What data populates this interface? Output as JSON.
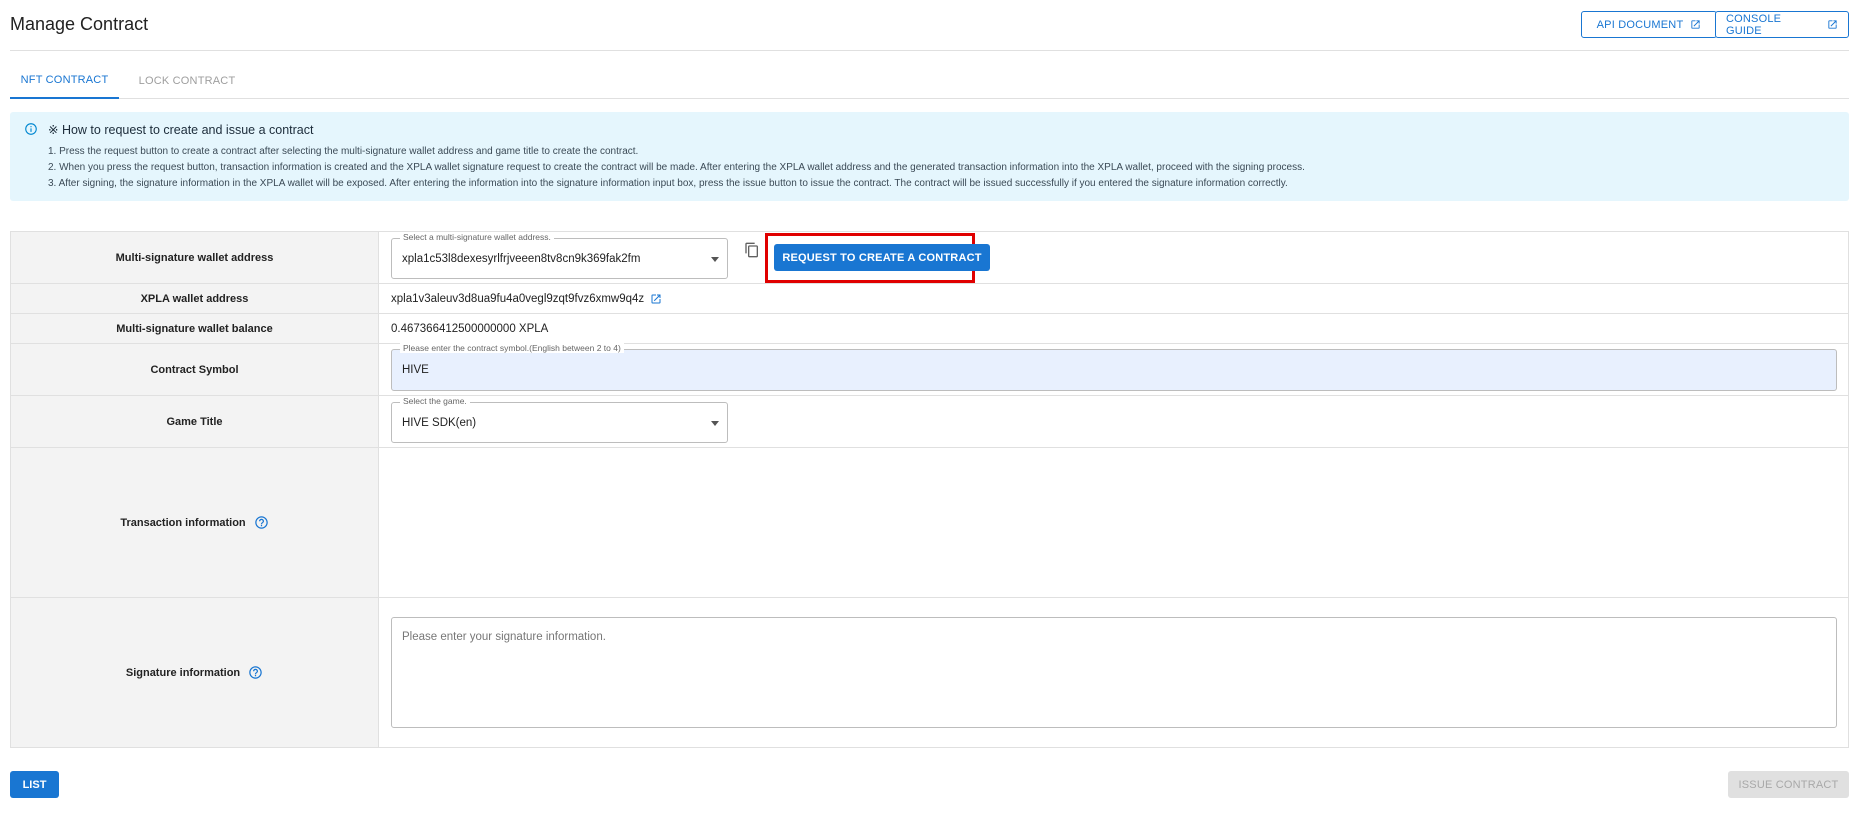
{
  "header": {
    "title": "Manage Contract",
    "api_document_label": "API DOCUMENT",
    "console_guide_label": "CONSOLE GUIDE"
  },
  "tabs": [
    {
      "label": "NFT CONTRACT",
      "active": true
    },
    {
      "label": "LOCK CONTRACT",
      "active": false
    }
  ],
  "info": {
    "title": "※ How to request to create and issue a contract",
    "lines": [
      "1. Press the request button to create a contract after selecting the multi-signature wallet address and game title to create the contract.",
      "2. When you press the request button, transaction information is created and the XPLA wallet signature request to create the contract will be made. After entering the XPLA wallet address and the generated transaction information into the XPLA wallet, proceed with the signing process.",
      "3. After signing, the signature information in the XPLA wallet will be exposed. After entering the information into the signature information input box, press the issue button to issue the contract. The contract will be issued successfully if you entered the signature information correctly."
    ]
  },
  "form": {
    "multisig": {
      "label": "Multi-signature wallet address",
      "legend": "Select a multi-signature wallet address.",
      "value": "xpla1c53l8dexesyrlfrjveeen8tv8cn9k369fak2fm",
      "request_button": "REQUEST TO CREATE A CONTRACT"
    },
    "xpla_wallet": {
      "label": "XPLA wallet address",
      "value": "xpla1v3aleuv3d8ua9fu4a0vegl9zqt9fvz6xmw9q4z"
    },
    "balance": {
      "label": "Multi-signature wallet balance",
      "value": "0.467366412500000000 XPLA"
    },
    "symbol": {
      "label": "Contract Symbol",
      "legend": "Please enter the contract symbol.(English between 2 to 4)",
      "value": "HIVE"
    },
    "game": {
      "label": "Game Title",
      "legend": "Select the game.",
      "value": "HIVE SDK(en)"
    },
    "transaction": {
      "label": "Transaction information"
    },
    "signature": {
      "label": "Signature information",
      "placeholder": "Please enter your signature information."
    }
  },
  "footer": {
    "list_label": "LIST",
    "issue_label": "ISSUE CONTRACT"
  },
  "colors": {
    "primary": "#1976d2",
    "info_bg": "#e5f6fd",
    "highlight": "#e00000",
    "label_bg": "#f3f3f3"
  }
}
